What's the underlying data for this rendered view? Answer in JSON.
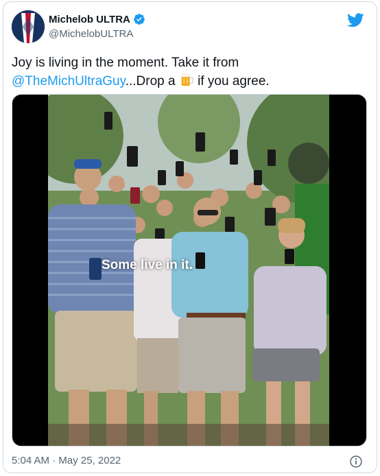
{
  "account": {
    "display_name": "Michelob ULTRA",
    "handle": "@MichelobULTRA",
    "verified_icon": "verified-badge-icon",
    "platform_icon": "twitter-bird-icon"
  },
  "tweet": {
    "text_line1": "Joy is living in the moment. Take it from",
    "mention": "@TheMichUltraGuy",
    "text_after_mention": "...Drop a",
    "emoji": "beer-mug-emoji",
    "text_end": "if you agree."
  },
  "media": {
    "caption": "Some live in it."
  },
  "footer": {
    "timestamp": "5:04 AM · May 25, 2022",
    "info_icon": "info-icon"
  },
  "colors": {
    "link": "#1d9bf0",
    "secondary_text": "#536471",
    "border": "#cfd9de"
  }
}
